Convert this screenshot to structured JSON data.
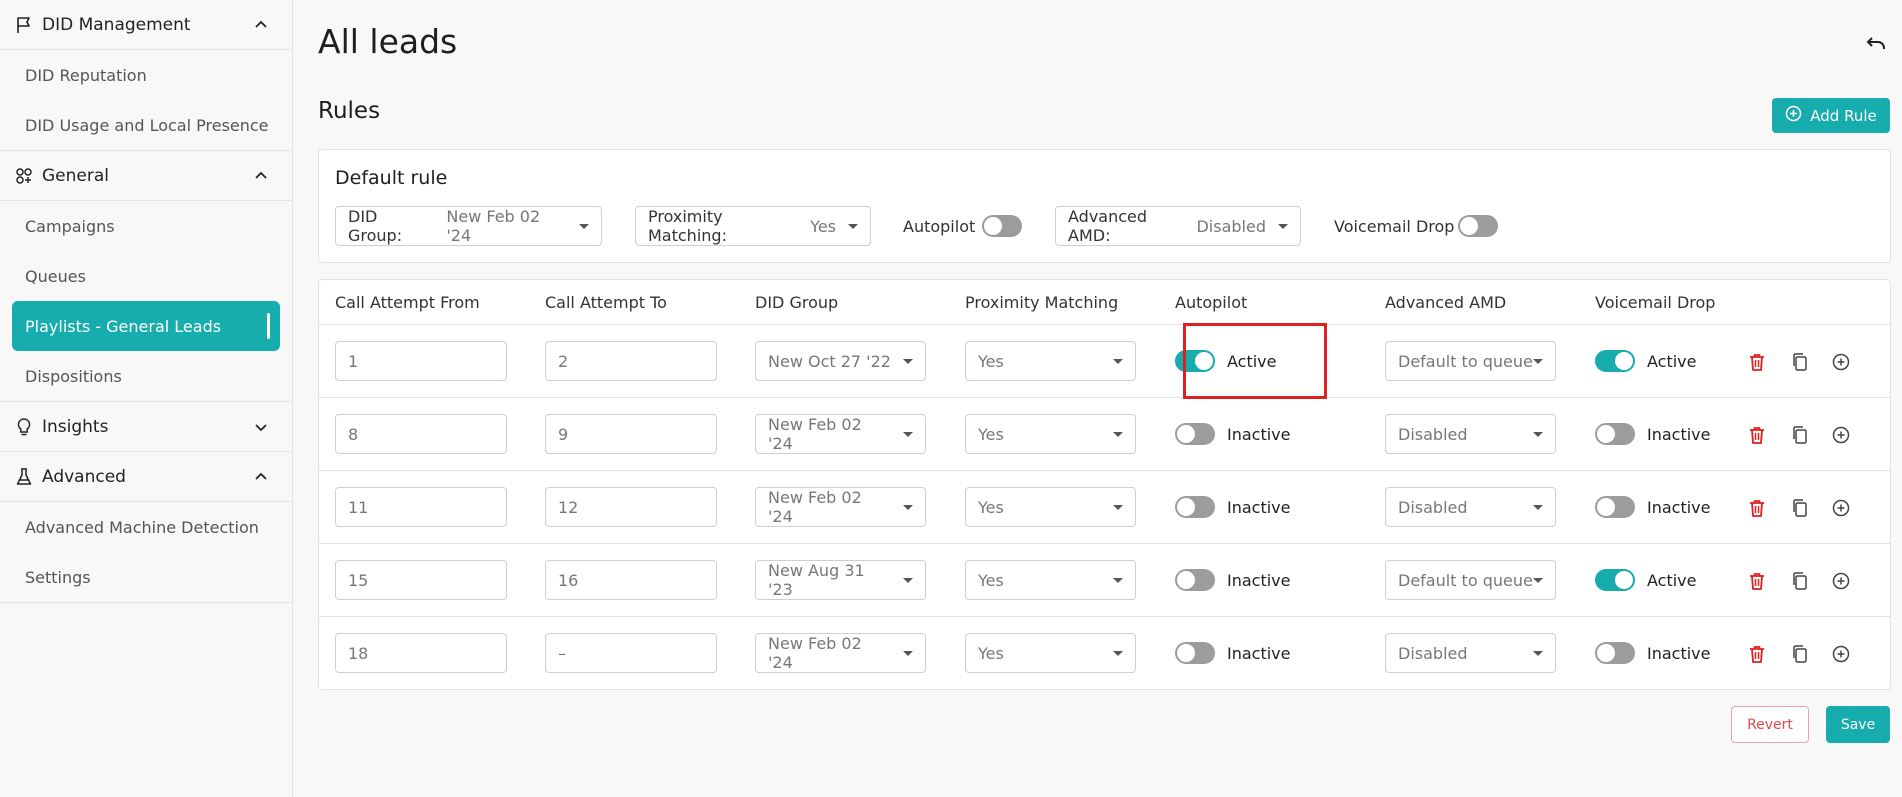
{
  "sidebar": {
    "sections": [
      {
        "label": "DID Management",
        "icon": "flag-icon",
        "expanded": true,
        "items": [
          "DID Reputation",
          "DID Usage and Local Presence"
        ]
      },
      {
        "label": "General",
        "icon": "people-icon",
        "expanded": true,
        "items": [
          "Campaigns",
          "Queues",
          "Playlists - General Leads",
          "Dispositions"
        ]
      },
      {
        "label": "Insights",
        "icon": "lightbulb-icon",
        "expanded": false,
        "items": []
      },
      {
        "label": "Advanced",
        "icon": "flask-icon",
        "expanded": true,
        "items": [
          "Advanced Machine Detection",
          "Settings"
        ]
      }
    ],
    "active_item": "Playlists - General Leads"
  },
  "page": {
    "title": "All leads",
    "rules_heading": "Rules",
    "add_rule_label": "Add Rule",
    "revert_label": "Revert",
    "save_label": "Save"
  },
  "default_rule": {
    "title": "Default rule",
    "did_group_label": "DID Group:",
    "did_group_value": "New Feb 02 '24",
    "proximity_label": "Proximity Matching:",
    "proximity_value": "Yes",
    "autopilot_label": "Autopilot",
    "autopilot_on": false,
    "amd_label": "Advanced AMD:",
    "amd_value": "Disabled",
    "voicemail_label": "Voicemail Drop",
    "voicemail_on": false
  },
  "table": {
    "headers": [
      "Call Attempt From",
      "Call Attempt To",
      "DID Group",
      "Proximity Matching",
      "Autopilot",
      "Advanced AMD",
      "Voicemail Drop"
    ],
    "rows": [
      {
        "from": "1",
        "to": "2",
        "did_group": "New Oct 27 '22",
        "proximity": "Yes",
        "autopilot_on": true,
        "autopilot_text": "Active",
        "amd": "Default to queue",
        "voicemail_on": true,
        "voicemail_text": "Active"
      },
      {
        "from": "8",
        "to": "9",
        "did_group": "New Feb 02 '24",
        "proximity": "Yes",
        "autopilot_on": false,
        "autopilot_text": "Inactive",
        "amd": "Disabled",
        "voicemail_on": false,
        "voicemail_text": "Inactive"
      },
      {
        "from": "11",
        "to": "12",
        "did_group": "New Feb 02 '24",
        "proximity": "Yes",
        "autopilot_on": false,
        "autopilot_text": "Inactive",
        "amd": "Disabled",
        "voicemail_on": false,
        "voicemail_text": "Inactive"
      },
      {
        "from": "15",
        "to": "16",
        "did_group": "New Aug 31 '23",
        "proximity": "Yes",
        "autopilot_on": false,
        "autopilot_text": "Inactive",
        "amd": "Default to queue",
        "voicemail_on": true,
        "voicemail_text": "Active"
      },
      {
        "from": "18",
        "to": "–",
        "did_group": "New Feb 02 '24",
        "proximity": "Yes",
        "autopilot_on": false,
        "autopilot_text": "Inactive",
        "amd": "Disabled",
        "voicemail_on": false,
        "voicemail_text": "Inactive"
      }
    ]
  },
  "colors": {
    "accent": "#17acad",
    "danger": "#e02020"
  }
}
